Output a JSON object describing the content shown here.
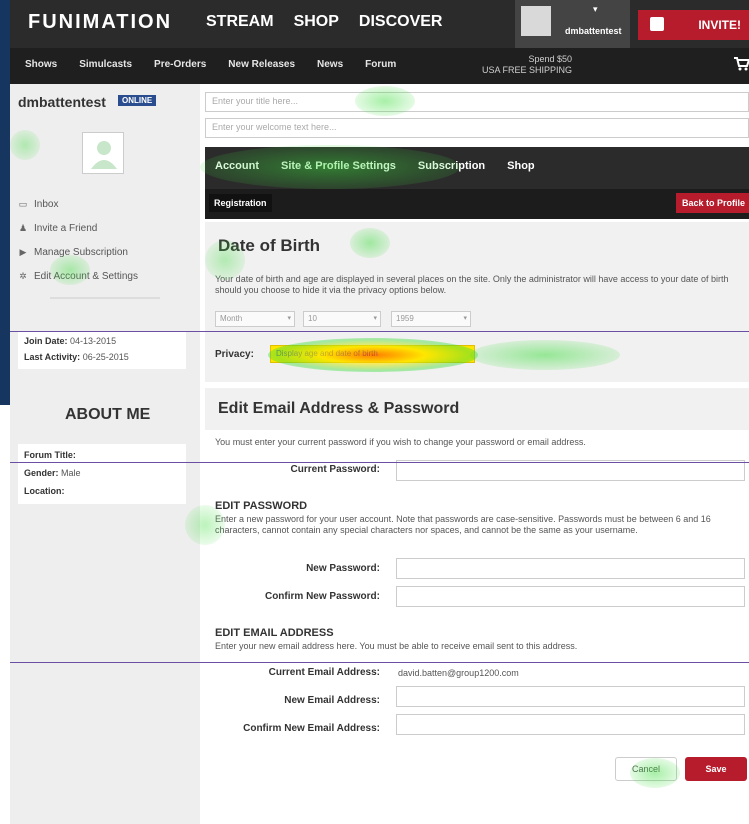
{
  "brand": "FUNIMATION",
  "main_nav": [
    "STREAM",
    "SHOP",
    "DISCOVER"
  ],
  "user_menu": {
    "username": "dmbattentest",
    "caret": "▾"
  },
  "invite_label": "INVITE!",
  "sub_nav": [
    "Shows",
    "Simulcasts",
    "Pre-Orders",
    "New Releases",
    "News",
    "Forum"
  ],
  "shipping": {
    "line1": "Spend $50",
    "line2": "USA FREE SHIPPING"
  },
  "sidebar": {
    "username": "dmbattentest",
    "status": "ONLINE",
    "links": [
      {
        "icon": "inbox-icon",
        "glyph": "▭",
        "label": "Inbox"
      },
      {
        "icon": "person-icon",
        "glyph": "♟",
        "label": "Invite a Friend"
      },
      {
        "icon": "play-icon",
        "glyph": "▶",
        "label": "Manage Subscription"
      },
      {
        "icon": "gear-icon",
        "glyph": "✲",
        "label": "Edit Account & Settings"
      }
    ],
    "join_date_label": "Join Date:",
    "join_date": "04-13-2015",
    "last_activity_label": "Last Activity:",
    "last_activity": "06-25-2015",
    "about_title": "ABOUT ME",
    "forum_title_label": "Forum Title:",
    "gender_label": "Gender:",
    "gender": "Male",
    "location_label": "Location:"
  },
  "title_placeholder": "Enter your title here...",
  "welcome_placeholder": "Enter your welcome text here...",
  "account_tabs": [
    "Account",
    "Site & Profile Settings",
    "Subscription",
    "Shop"
  ],
  "registration_tab": "Registration",
  "back_to_profile": "Back to Profile",
  "dob": {
    "heading": "Date of Birth",
    "description": "Your date of birth and age are displayed in several places on the site. Only the administrator will have access to your date of birth should you choose to hide it via the privacy options below.",
    "month": "Month",
    "day": "10",
    "year": "1959",
    "privacy_label": "Privacy:",
    "privacy_value": "Display age and date of birth"
  },
  "email_section": {
    "heading": "Edit Email Address & Password",
    "description": "You must enter your current password if you wish to change your password or email address.",
    "current_password_label": "Current Password:",
    "edit_password_heading": "EDIT PASSWORD",
    "edit_password_desc": "Enter a new password for your user account. Note that passwords are case-sensitive. Passwords must be between 6 and 16 characters, cannot contain any special characters nor spaces, and cannot be the same as your username.",
    "new_password_label": "New Password:",
    "confirm_password_label": "Confirm New Password:",
    "edit_email_heading": "EDIT EMAIL ADDRESS",
    "edit_email_desc": "Enter your new email address here. You must be able to receive email sent to this address.",
    "current_email_label": "Current Email Address:",
    "current_email": "david.batten@group1200.com",
    "new_email_label": "New Email Address:",
    "confirm_email_label": "Confirm New Email Address:"
  },
  "buttons": {
    "cancel": "Cancel",
    "save": "Save"
  }
}
